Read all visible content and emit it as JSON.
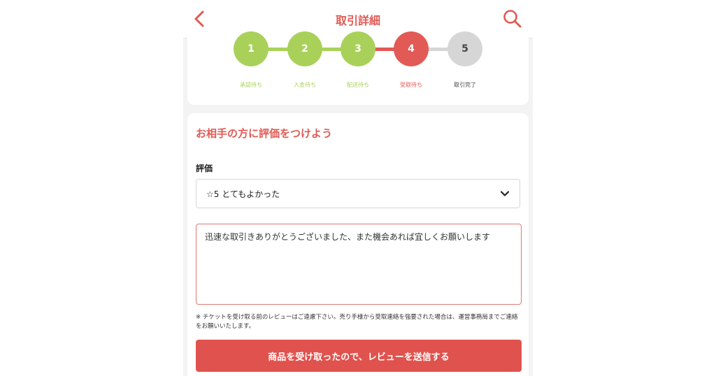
{
  "header": {
    "title": "取引詳細"
  },
  "steps": [
    {
      "number": "1",
      "label": "承認待ち",
      "status": "done"
    },
    {
      "number": "2",
      "label": "入金待ち",
      "status": "done"
    },
    {
      "number": "3",
      "label": "配送待ち",
      "status": "done"
    },
    {
      "number": "4",
      "label": "受取待ち",
      "status": "current"
    },
    {
      "number": "5",
      "label": "取引完了",
      "status": "pending"
    }
  ],
  "review": {
    "title": "お相手の方に評価をつけよう",
    "rating_label": "評価",
    "rating_selected": "☆5 とてもよかった",
    "comment": "迅速な取引きありがとうございました、また機会あれば宜しくお願いします",
    "notice": "※ チケットを受け取る前のレビューはご遠慮下さい。売り手様から受取連絡を強要された場合は、運営事務局までご連絡をお願いいたします。",
    "submit_label": "商品を受け取ったので、レビューを送信する"
  },
  "icons": {
    "back": "chevron-left-icon",
    "search": "search-icon",
    "dropdown": "chevron-down-icon"
  },
  "colors": {
    "accent": "#e05a55",
    "done": "#a9d15a",
    "current": "#e25a55",
    "pending": "#d6d6d6",
    "pending_text": "#444444"
  }
}
